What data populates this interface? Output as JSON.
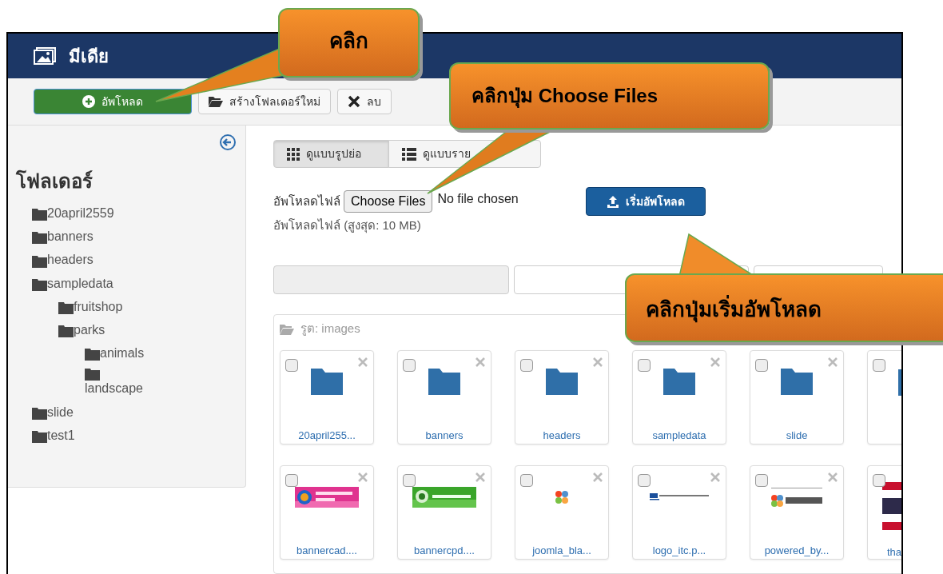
{
  "header": {
    "title": "มีเดีย"
  },
  "toolbar": {
    "buttons": [
      {
        "label": "อัพโหลด",
        "kind": "upload"
      },
      {
        "label": "สร้างโฟลเดอร์ใหม่",
        "kind": "folder"
      },
      {
        "label": "ลบ",
        "kind": "delete"
      }
    ]
  },
  "sidebar": {
    "title": "โฟลเดอร์",
    "tree": [
      {
        "label": "20april2559"
      },
      {
        "label": "banners"
      },
      {
        "label": "headers"
      },
      {
        "label": "sampledata",
        "children": [
          {
            "label": "fruitshop"
          },
          {
            "label": "parks",
            "children": [
              {
                "label": "animals"
              },
              {
                "label": "landscape"
              }
            ]
          }
        ]
      },
      {
        "label": "slide"
      },
      {
        "label": "test1"
      }
    ]
  },
  "view_tabs": [
    {
      "label": "ดูแบบรูปย่อ",
      "kind": "grid",
      "selected": true
    },
    {
      "label": "ดูแบบราย",
      "kind": "list",
      "selected": false
    }
  ],
  "upload": {
    "label": "อัพโหลดไฟล์",
    "choose_button": "Choose Files",
    "file_status": "No file chosen",
    "start_button": "เริ่มอัพโหลด",
    "hint": "อัพโหลดไฟล์ (สูงสุด: 10 MB)"
  },
  "browser": {
    "path": "รูต: images",
    "items": [
      {
        "kind": "folder",
        "name": "20april255...",
        "checked": false
      },
      {
        "kind": "folder",
        "name": "banners",
        "checked": false
      },
      {
        "kind": "folder",
        "name": "headers",
        "checked": false
      },
      {
        "kind": "folder",
        "name": "sampledata",
        "checked": false
      },
      {
        "kind": "folder",
        "name": "slide",
        "checked": false
      },
      {
        "kind": "folder",
        "checked": false
      },
      {
        "kind": "picture",
        "name": "bannercad....",
        "checked": false
      },
      {
        "kind": "picture",
        "name": "bannercpd....",
        "checked": false
      },
      {
        "kind": "picture",
        "name": "joomla_bla...",
        "checked": false
      },
      {
        "kind": "picture",
        "name": "logo_itc.p...",
        "checked": false
      },
      {
        "kind": "picture",
        "name": "powered_by...",
        "checked": false
      },
      {
        "kind": "picture",
        "name": "tha",
        "checked": false
      }
    ]
  },
  "callouts": [
    {
      "text": "คลิก"
    },
    {
      "text": "คลิกปุ่ม Choose Files"
    },
    {
      "text": "คลิกปุ่มเริ่มอัพโหลด"
    }
  ]
}
